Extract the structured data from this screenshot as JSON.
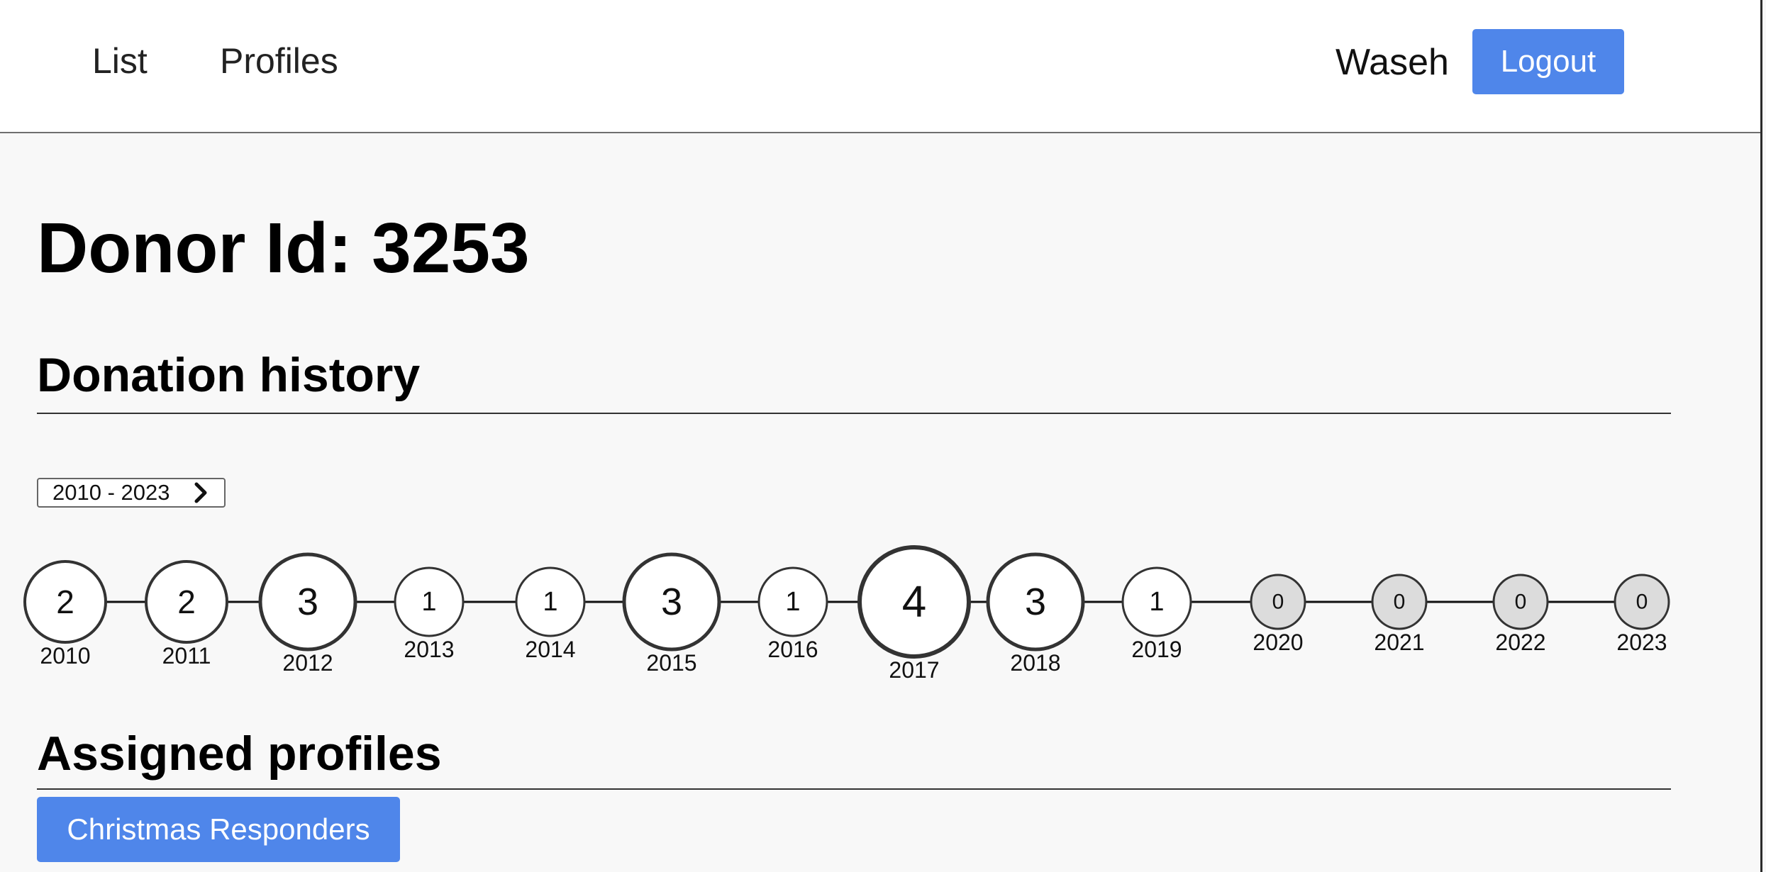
{
  "nav": {
    "items": [
      {
        "label": "List"
      },
      {
        "label": "Profiles"
      }
    ],
    "user_name": "Waseh",
    "logout_label": "Logout"
  },
  "page": {
    "title": "Donor Id: 3253"
  },
  "donation_history": {
    "heading": "Donation history",
    "range_label": "2010 - 2023",
    "range_icon": "chevron-right-icon",
    "years": [
      {
        "year": "2010",
        "count": 2
      },
      {
        "year": "2011",
        "count": 2
      },
      {
        "year": "2012",
        "count": 3
      },
      {
        "year": "2013",
        "count": 1
      },
      {
        "year": "2014",
        "count": 1
      },
      {
        "year": "2015",
        "count": 3
      },
      {
        "year": "2016",
        "count": 1
      },
      {
        "year": "2017",
        "count": 4
      },
      {
        "year": "2018",
        "count": 3
      },
      {
        "year": "2019",
        "count": 1
      },
      {
        "year": "2020",
        "count": 0
      },
      {
        "year": "2021",
        "count": 0
      },
      {
        "year": "2022",
        "count": 0
      },
      {
        "year": "2023",
        "count": 0
      }
    ]
  },
  "assigned_profiles": {
    "heading": "Assigned profiles",
    "profiles": [
      "Christmas Responders"
    ]
  },
  "colors": {
    "accent": "#4f86ea",
    "node_active_fill": "#ffffff",
    "node_empty_fill": "#dcdcdc",
    "node_stroke": "#333333",
    "page_background": "#f8f8f8"
  }
}
